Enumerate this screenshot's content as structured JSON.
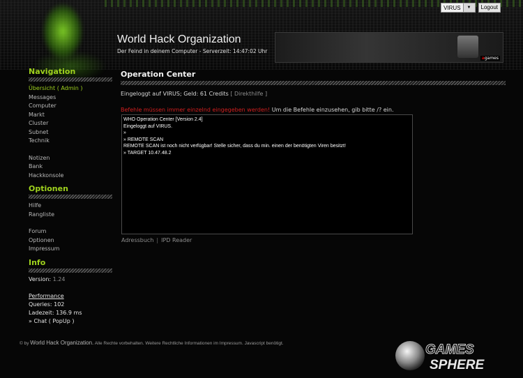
{
  "header": {
    "user_select": "VIRUS",
    "logout_label": "Logout",
    "site_title": "World Hack Organization",
    "subtitle": "Der Feind in deinem Computer - Serverzeit: 14:47:02 Uhr",
    "banner_logo": "games"
  },
  "sidebar": {
    "navigation_title": "Navigation",
    "nav_items": [
      {
        "label": "Übersicht",
        "extra": "( Admin )"
      },
      {
        "label": "Messages"
      },
      {
        "label": "Computer"
      },
      {
        "label": "Markt"
      },
      {
        "label": "Cluster"
      },
      {
        "label": "Subnet"
      },
      {
        "label": "Technik"
      }
    ],
    "nav_items2": [
      "Notizen",
      "Bank",
      "Hackkonsole"
    ],
    "options_title": "Optionen",
    "option_items": [
      "Hilfe",
      "Rangliste"
    ],
    "option_items2": [
      "Forum",
      "Optionen",
      "Impressum"
    ],
    "info_title": "Info",
    "version_label": "Version:",
    "version_value": "1.24",
    "performance_title": "Performance",
    "queries": "Queries: 102",
    "ladezeit": "Ladezeit: 136.9 ms",
    "chat": "» Chat",
    "popup": "( PopUp )"
  },
  "main": {
    "title": "Operation Center",
    "login_text": "Eingeloggt auf VIRUS; Geld: 61 Credits",
    "direkthilfe": "[ Direkthilfe ]",
    "warning_red": "Befehle müssen immer einzelnd eingegeben werden!",
    "warning_rest": " Um die Befehle einzusehen, gib bitte /? ein.",
    "console_lines": [
      "WHO Operation Center [Version 2.4]",
      "Eingeloggt auf VIRUS.",
      "»",
      "» REMOTE SCAN",
      "REMOTE SCAN ist noch nicht verfügbar! Stelle sicher, dass du min. einen der benötigten Viren besitzt!",
      "» TARGET 10.47.48.2"
    ],
    "link_adressbuch": "Adressbuch",
    "link_separator": "|",
    "link_ipd": "IPD Reader"
  },
  "footer": {
    "copyright": "© by",
    "org": "World Hack Organization.",
    "rest": " Alle Rechte vorbehalten. Weitere Rechtliche Informationen im Impressum. Javascript benötigt.",
    "logo_line1": "GAMES",
    "logo_line2": "SPHERE"
  },
  "colors": {
    "accent_green": "#9fd21e",
    "warning_red": "#d21f1f",
    "background": "#060606"
  }
}
